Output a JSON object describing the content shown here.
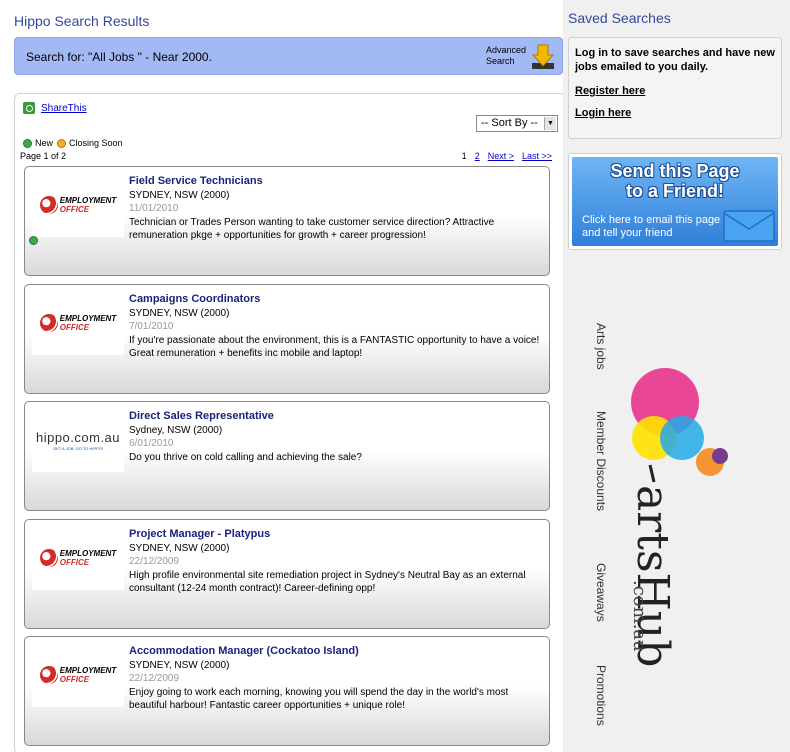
{
  "main": {
    "title": "Hippo Search Results",
    "search_summary": "Search for: \"All Jobs \" - Near 2000.",
    "advanced_search_label": "Advanced Search",
    "share_label": "ShareThis",
    "sort_label": "-- Sort By --",
    "legend": {
      "new": "New",
      "closing": "Closing Soon"
    },
    "page_of": "Page 1 of 2",
    "pager": {
      "p1": "1",
      "p2": "2",
      "next": "Next >",
      "last": "Last >>"
    },
    "jobs": [
      {
        "title": "Field Service Technicians",
        "location": "SYDNEY, NSW (2000)",
        "date": "11/01/2010",
        "description": "Technician or Trades Person wanting to take customer service direction? Attractive remuneration pkge + opportunities for growth + career progression!",
        "logo": "employment-office",
        "is_new": true
      },
      {
        "title": "Campaigns Coordinators",
        "location": "SYDNEY, NSW (2000)",
        "date": "7/01/2010",
        "description": "If you're passionate about the environment, this is a FANTASTIC opportunity to have a voice! Great remuneration + benefits inc mobile and laptop!",
        "logo": "employment-office",
        "is_new": false
      },
      {
        "title": "Direct Sales Representative",
        "location": "Sydney, NSW (2000)",
        "date": "6/01/2010",
        "description": "Do you thrive on cold calling and achieving the sale?",
        "logo": "hippo",
        "is_new": false
      },
      {
        "title": "Project Manager - Platypus",
        "location": "SYDNEY, NSW (2000)",
        "date": "22/12/2009",
        "description": "High profile environmental site remediation project in Sydney's Neutral Bay as an external consultant (12-24 month contract)! Career-defining opp!",
        "logo": "employment-office",
        "is_new": false
      },
      {
        "title": "Accommodation Manager (Cockatoo Island)",
        "location": "SYDNEY, NSW (2000)",
        "date": "22/12/2009",
        "description": "Enjoy going to work each morning, knowing you will spend the day in the world's most beautiful harbour! Fantastic career opportunities + unique role!",
        "logo": "employment-office",
        "is_new": false
      }
    ],
    "logos": {
      "employment_office_1": "EMPLOYMENT",
      "employment_office_2": "OFFICE",
      "hippo_text": "hippo.com.au",
      "hippo_tagline": "GET A JOB. GO TO HIPPO!"
    }
  },
  "side": {
    "saved_title": "Saved Searches",
    "login_text": "Log in to save searches and have new jobs emailed to you daily.",
    "register_label": "Register here",
    "login_label": "Login here",
    "friend_heading_1": "Send this Page",
    "friend_heading_2": "to a Friend!",
    "friend_sub": "Click here to email this page and tell your friend",
    "ad": {
      "words": [
        "Arts jobs",
        "Member Discounts",
        "Giveaways",
        "Promotions"
      ],
      "brand": "artsHub",
      "brand_suffix": ".com.au"
    }
  },
  "colors": {
    "title": "#33499c",
    "search_bar": "#a3b9f5",
    "job_title": "#1a237e",
    "link": "#0000cc"
  }
}
